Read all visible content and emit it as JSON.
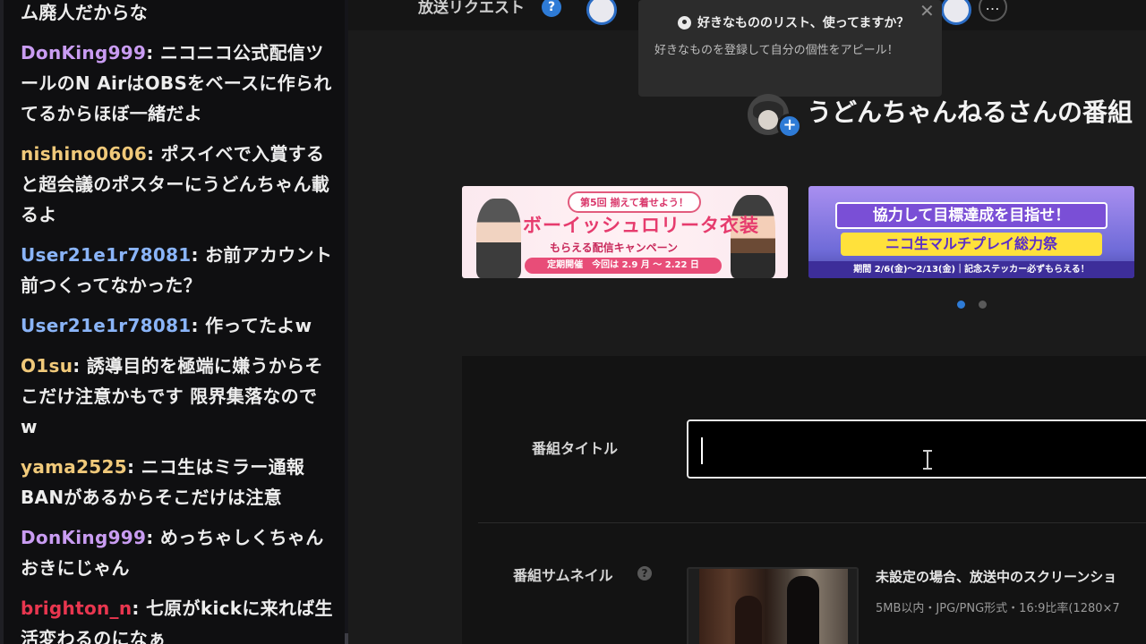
{
  "chat": {
    "messages": [
      {
        "user": "",
        "user_color": "#ededed",
        "text": "ム廃人だからな"
      },
      {
        "user": "DonKing999",
        "user_color": "#c99cf2",
        "text": "ニコニコ公式配信ツールのN AirはOBSをベースに作られてるからほぼ一緒だよ"
      },
      {
        "user": "nishino0606",
        "user_color": "#f0c97a",
        "text": "ポスイベで入賞すると超会議のポスターにうどんちゃん載るよ"
      },
      {
        "user": "User21e1r78081",
        "user_color": "#8ab4f8",
        "text": "お前アカウント前つくってなかった？"
      },
      {
        "user": "User21e1r78081",
        "user_color": "#8ab4f8",
        "text": "作ってたよw"
      },
      {
        "user": "O1su",
        "user_color": "#f0c97a",
        "text": "誘導目的を極端に嫌うからそこだけ注意かもです 限界集落なのでw"
      },
      {
        "user": "yama2525",
        "user_color": "#f0c97a",
        "text": "ニコ生はミラー通報BANがあるからそこだけは注意"
      },
      {
        "user": "DonKing999",
        "user_color": "#c99cf2",
        "text": "めっちゃしくちゃんおきにじゃん"
      },
      {
        "user": "brighton_n",
        "user_color": "#e8364f",
        "text": "七原がkickに来れば生活変わるのになぁ"
      }
    ]
  },
  "topbar": {
    "title": "放送リクエスト",
    "help_icon": "?",
    "more_icon": "…"
  },
  "popup": {
    "icon": "pin-icon",
    "title": "好きなもののリスト、使ってますか？",
    "body": "好きなものを登録して自分の個性をアピール！",
    "close": "✕"
  },
  "program": {
    "heading": "うどんちゃんねるさんの番組",
    "plus": "+"
  },
  "banners": [
    {
      "tag": "第5回 揃えて着せよう！",
      "title": "ボーイッシュロリータ衣装",
      "subtitle": "もらえる配信キャンペーン",
      "date": "定期開催　今回は 2.9 月 ～ 2.22 日"
    },
    {
      "title": "協力して目標達成を目指せ！",
      "subtitle": "ニコ生マルチプレイ総力祭",
      "date": "期間 2/6(金)～2/13(金)｜記念ステッカー必ずもらえる！"
    }
  ],
  "carousel": {
    "active_index": 0,
    "count": 2
  },
  "form": {
    "title_label": "番組タイトル",
    "title_value": "",
    "thumbnail_label": "番組サムネイル",
    "help_icon": "?",
    "thumbnail_note": "未設定の場合、放送中のスクリーンショ",
    "thumbnail_spec": "5MB以内・JPG/PNG形式・16:9比率(1280×7"
  },
  "colors": {
    "accent": "#2e7bd6",
    "chat_bg": "#0f0f11",
    "page_bg": "#1b1b1b"
  }
}
